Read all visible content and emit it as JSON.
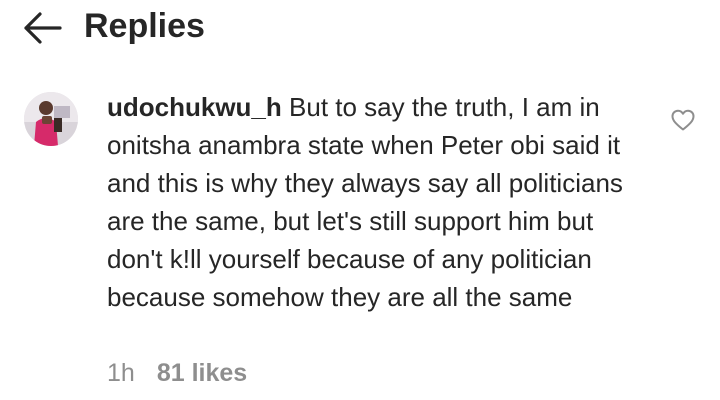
{
  "header": {
    "back_icon": "arrow-left-icon",
    "title": "Replies"
  },
  "comment": {
    "username": "udochukwu_h",
    "text": "But to say the truth, I am in onitsha anambra state when Peter obi said it  and this is why they always say all politicians are the same, but let's still support him but don't k!ll yourself because of any politician because somehow they are all the same",
    "time": "1h",
    "likes": "81 likes",
    "like_icon": "heart-outline-icon"
  },
  "colors": {
    "text": "#262626",
    "secondary": "#8e8e8e",
    "background": "#ffffff"
  }
}
